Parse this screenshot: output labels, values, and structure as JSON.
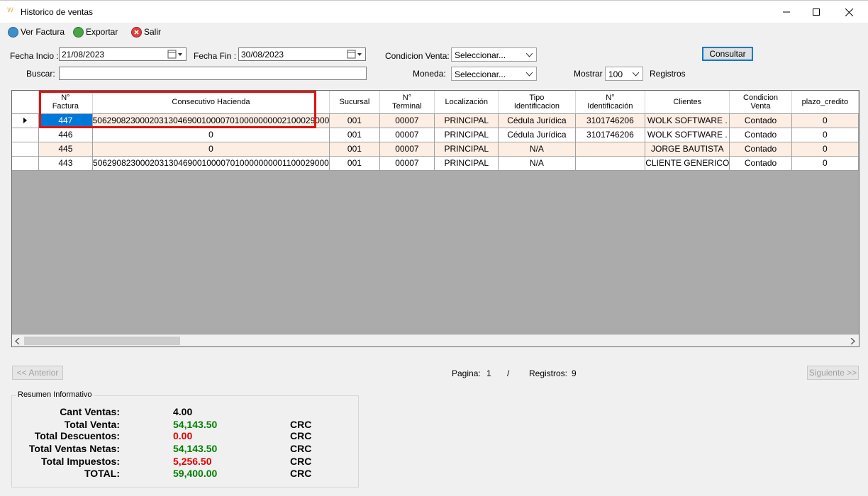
{
  "window": {
    "title": "Historico de ventas"
  },
  "toolbar": {
    "ver_factura": "Ver Factura",
    "exportar": "Exportar",
    "salir": "Salir"
  },
  "filters": {
    "fecha_inicio_label": "Fecha Incio :",
    "fecha_inicio": "21/08/2023",
    "fecha_fin_label": "Fecha Fin :",
    "fecha_fin": "30/08/2023",
    "condicion_label": "Condicion Venta:",
    "condicion_value": "Seleccionar...",
    "moneda_label": "Moneda:",
    "moneda_value": "Seleccionar...",
    "buscar_label": "Buscar:",
    "buscar_value": "",
    "mostrar_label": "Mostrar",
    "mostrar_value": "100",
    "registros_label": "Registros",
    "consultar": "Consultar"
  },
  "grid": {
    "columns": [
      "N°\nFactura",
      "Consecutivo Hacienda",
      "Sucursal",
      "N°\nTerminal",
      "Localización",
      "Tipo\nIdentificacion",
      "N°\nIdentificación",
      "Clientes",
      "Condicion\nVenta",
      "plazo_credito"
    ],
    "rows": [
      [
        "447",
        "50629082300020313046900100007010000000002100029000",
        "001",
        "00007",
        "PRINCIPAL",
        "Cédula Jurídica",
        "3101746206",
        "WOLK SOFTWARE .",
        "Contado",
        "0"
      ],
      [
        "446",
        "0",
        "001",
        "00007",
        "PRINCIPAL",
        "Cédula Jurídica",
        "3101746206",
        "WOLK SOFTWARE .",
        "Contado",
        "0"
      ],
      [
        "445",
        "0",
        "001",
        "00007",
        "PRINCIPAL",
        "N/A",
        "",
        "JORGE BAUTISTA",
        "Contado",
        "0"
      ],
      [
        "443",
        "50629082300020313046900100007010000000001100029000",
        "001",
        "00007",
        "PRINCIPAL",
        "N/A",
        "",
        "CLIENTE GENERICO",
        "Contado",
        "0"
      ]
    ]
  },
  "pager": {
    "anterior": "<< Anterior",
    "siguiente": "Siguiente >>",
    "pagina_label": "Pagina:",
    "pagina_value": "1",
    "separator": "/",
    "registros_label": "Registros:",
    "registros_value": "9"
  },
  "summary": {
    "title": "Resumen Informativo",
    "rows": [
      {
        "label": "Cant Ventas:",
        "value": "4.00",
        "currency": "",
        "color": "#000000"
      },
      {
        "label": "Total Venta:",
        "value": "54,143.50",
        "currency": "CRC",
        "color": "#008000"
      },
      {
        "label": "Total Descuentos:",
        "value": "0.00",
        "currency": "CRC",
        "color": "#e00000"
      },
      {
        "label": "Total Ventas Netas:",
        "value": "54,143.50",
        "currency": "CRC",
        "color": "#008000"
      },
      {
        "label": "Total Impuestos:",
        "value": "5,256.50",
        "currency": "CRC",
        "color": "#e00000"
      },
      {
        "label": "TOTAL:",
        "value": "59,400.00",
        "currency": "CRC",
        "color": "#008000"
      }
    ]
  },
  "colors": {
    "selection": "#0078d7",
    "highlight_box": "#e3120f",
    "odd_row": "#fdeee4"
  }
}
